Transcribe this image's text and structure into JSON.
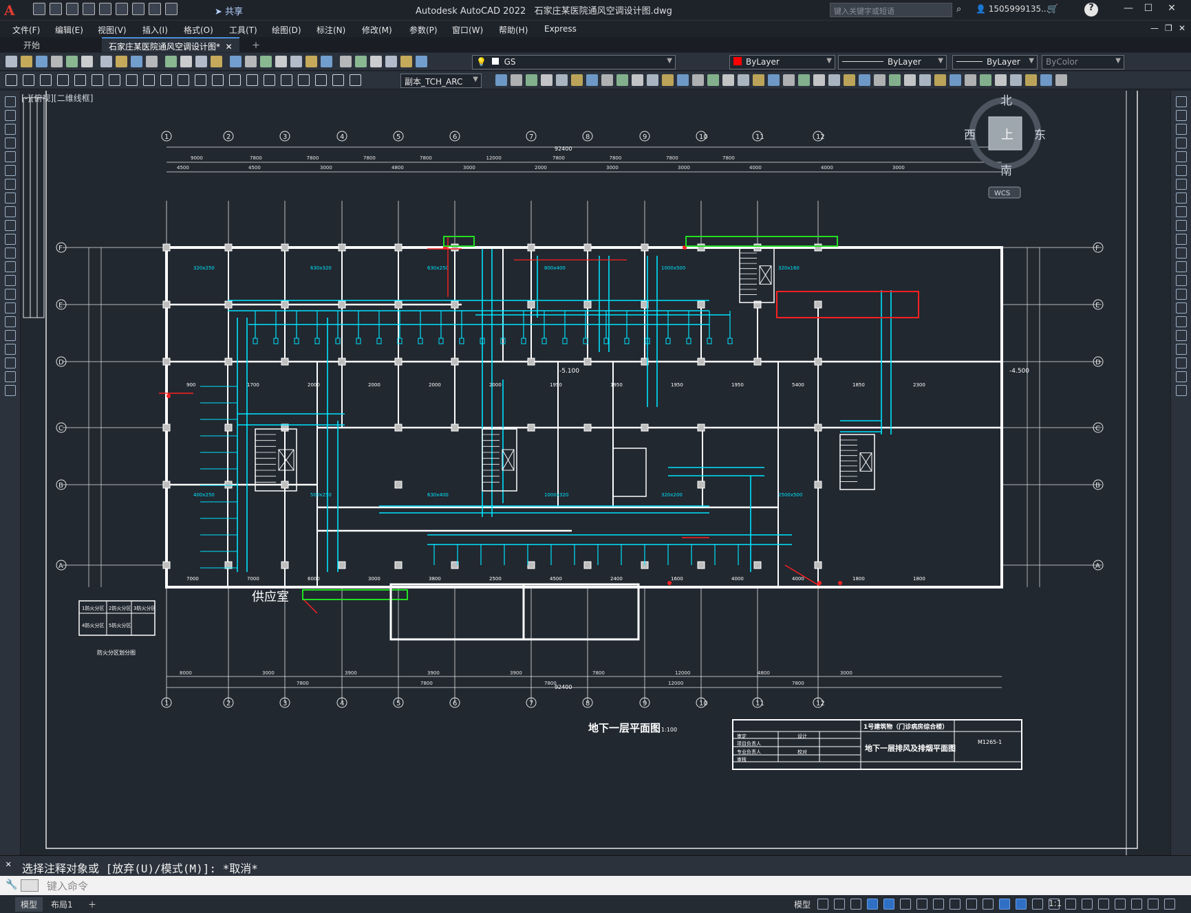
{
  "app": {
    "name_prefix": "Autodesk AutoCAD 2022",
    "file_title": "石家庄某医院通风空调设计图.dwg",
    "share_label": "共享",
    "search_placeholder": "键入关键字或短语",
    "user_label": "1505999135...",
    "help_label": "?"
  },
  "menu": [
    "文件(F)",
    "编辑(E)",
    "视图(V)",
    "插入(I)",
    "格式(O)",
    "工具(T)",
    "绘图(D)",
    "标注(N)",
    "修改(M)",
    "参数(P)",
    "窗口(W)",
    "帮助(H)",
    "Express"
  ],
  "tabs": [
    {
      "label": "开始",
      "active": false
    },
    {
      "label": "石家庄某医院通风空调设计图*",
      "active": true
    }
  ],
  "toolbar": {
    "layer_value": "GS",
    "color_value": "ByLayer",
    "linetype_value": "ByLayer",
    "lineweight_value": "ByLayer",
    "plotstyle_value": "ByColor",
    "textstyle_value": "副本_TCH_ARC"
  },
  "viewport": {
    "label": "[-][俯视][二维线框]",
    "viewcube": {
      "north": "北",
      "south": "南",
      "east": "东",
      "west": "西",
      "top": "上",
      "wcs": "WCS"
    }
  },
  "drawing": {
    "title": "地下一层平面图",
    "scale": "1:100",
    "room_label": "供应室",
    "elevation_right": "-4.500",
    "elevation_center": "-5.100",
    "total_dim": "92400",
    "grid_cols": [
      "1",
      "2",
      "3",
      "4",
      "5",
      "6",
      "7",
      "8",
      "9",
      "10",
      "11",
      "12"
    ],
    "grid_rows": [
      "F",
      "E",
      "D",
      "C",
      "B",
      "A"
    ],
    "top_dims_1": [
      "9000",
      "7800",
      "7800",
      "7800",
      "7800",
      "12000",
      "7800",
      "7800",
      "7800",
      "7800"
    ],
    "top_dims_2": [
      "4500",
      "4500",
      "3000",
      "4800",
      "3000",
      "2000",
      "3000",
      "3000",
      "4000",
      "4000",
      "3000"
    ],
    "bottom_dims_1": [
      "8000",
      "3000",
      "3900",
      "3900",
      "3900",
      "7800",
      "12000",
      "4800",
      "3000"
    ],
    "bottom_dims_2": [
      "7800",
      "7800",
      "7800",
      "12000",
      "7800"
    ],
    "duct_dims": [
      "7000",
      "7000",
      "6000",
      "3000",
      "3800",
      "2500",
      "4500",
      "2400",
      "1600",
      "4000",
      "4000",
      "1800",
      "1800",
      "900",
      "1700",
      "2000",
      "2000",
      "2000",
      "2000",
      "1950",
      "1950",
      "1950",
      "1950",
      "5400",
      "1850",
      "2300"
    ],
    "duct_labels": [
      "320x250",
      "630x320",
      "630x250",
      "800x400",
      "1000x500",
      "320x160",
      "400x250",
      "500x250",
      "630x400",
      "1000x320",
      "320x200",
      "2500x500"
    ],
    "legend_cells": [
      "1防火分区",
      "2防火分区",
      "3防火分区",
      "4防火分区",
      "5防火分区"
    ],
    "legend_caption": "防火分区划分图"
  },
  "titleblock": {
    "project": "1号建筑物（门诊病房综合楼）",
    "sheet": "地下一层排风及排烟平面图",
    "number": "M1265-1",
    "rows": [
      "审定",
      "项目负责人",
      "专业负责人",
      "审核",
      "设计",
      "校对"
    ]
  },
  "command": {
    "history": "选择注释对象或 [放弃(U)/模式(M)]: *取消*",
    "placeholder": "键入命令"
  },
  "status": {
    "model_tab": "模型",
    "layout_tab": "布局1",
    "model_label": "模型",
    "scale_label": "1:1"
  },
  "colors": {
    "background": "#212830",
    "duct": "#00e5ff",
    "wall": "#ffffff",
    "highlight_red": "#ff2020",
    "highlight_green": "#22e022",
    "dim": "#e8e8e8",
    "text_yellow": "#ffff40",
    "accent": "#e23b2e"
  }
}
